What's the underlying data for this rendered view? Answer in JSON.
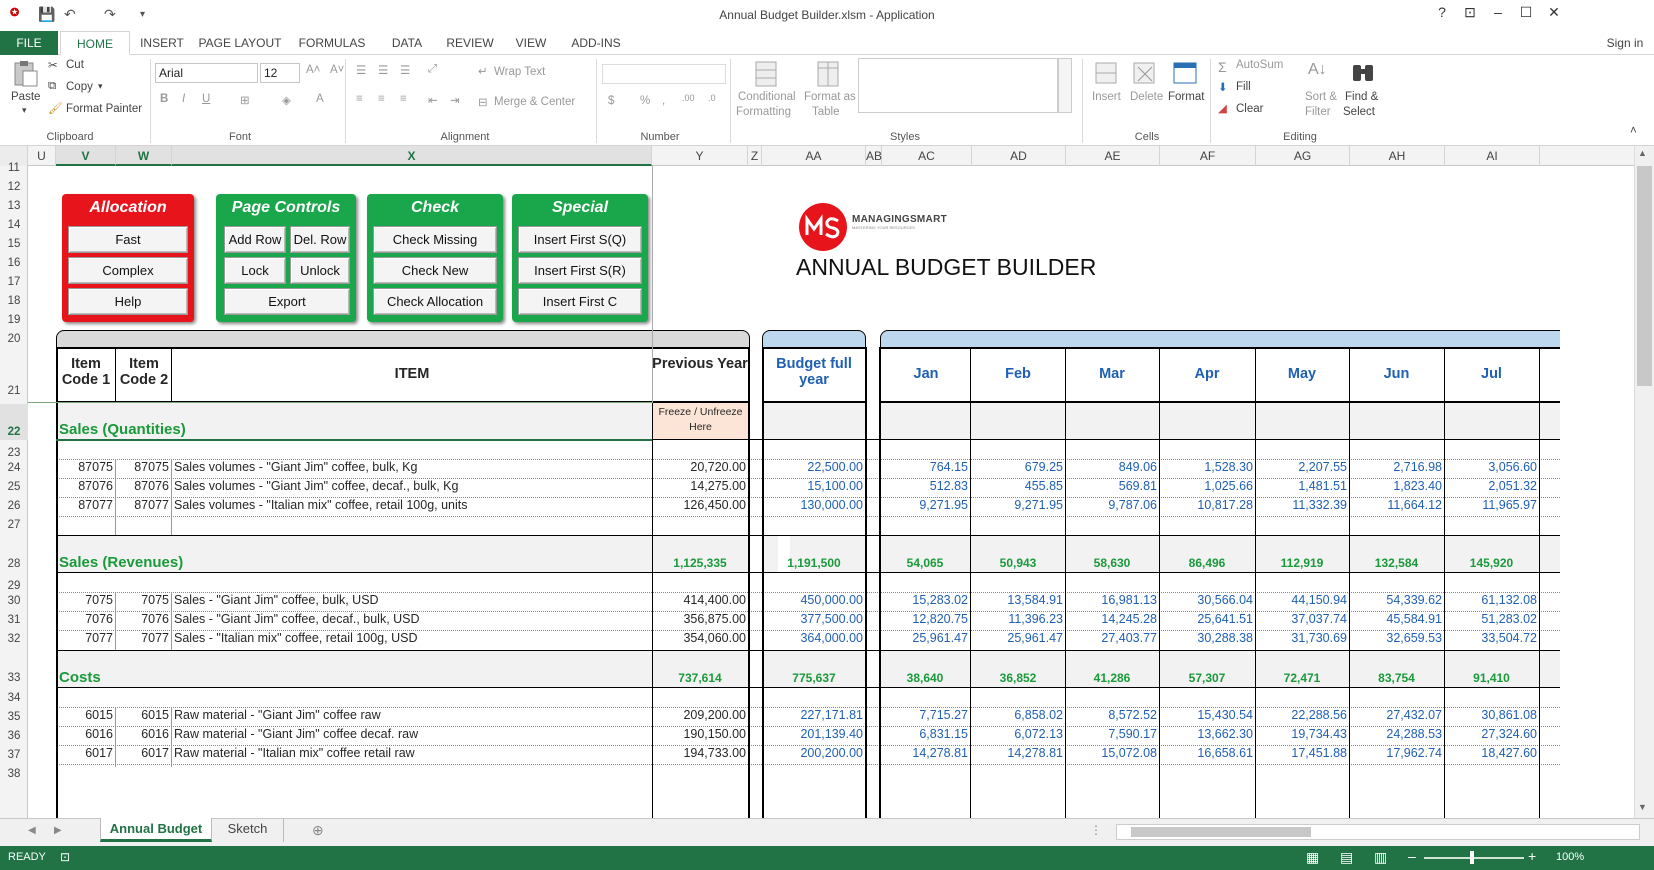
{
  "window": {
    "title": "Annual Budget Builder.xlsm - Application"
  },
  "ribbon_tabs": [
    "FILE",
    "HOME",
    "INSERT",
    "PAGE LAYOUT",
    "FORMULAS",
    "DATA",
    "REVIEW",
    "VIEW",
    "ADD-INS"
  ],
  "sign_in": "Sign in",
  "clipboard": {
    "paste": "Paste",
    "cut": "Cut",
    "copy": "Copy",
    "format_painter": "Format Painter",
    "label": "Clipboard"
  },
  "font": {
    "name": "Arial",
    "size": "12",
    "label": "Font"
  },
  "alignment": {
    "wrap": "Wrap Text",
    "merge": "Merge & Center",
    "label": "Alignment"
  },
  "number": {
    "label": "Number",
    "currency": "$",
    "percent": "%"
  },
  "styles": {
    "conditional": "Conditional",
    "formatting": "Formatting",
    "format_as": "Format as",
    "table": "Table",
    "label": "Styles"
  },
  "cells": {
    "insert": "Insert",
    "delete": "Delete",
    "format": "Format",
    "label": "Cells"
  },
  "editing": {
    "autosum": "AutoSum",
    "fill": "Fill",
    "clear": "Clear",
    "sort": "Sort &",
    "filter": "Filter",
    "find": "Find &",
    "select": "Select",
    "label": "Editing"
  },
  "columns": [
    "U",
    "V",
    "W",
    "X",
    "Y",
    "Z",
    "AA",
    "AB",
    "AC",
    "AD",
    "AE",
    "AF",
    "AG",
    "AH",
    "AI"
  ],
  "rows": [
    "11",
    "12",
    "13",
    "14",
    "15",
    "16",
    "17",
    "18",
    "19",
    "20",
    "21",
    "22",
    "23",
    "24",
    "25",
    "26",
    "27",
    "28",
    "29",
    "30",
    "31",
    "32",
    "33",
    "34",
    "35",
    "36",
    "37",
    "38"
  ],
  "macros": {
    "allocation": {
      "title": "Allocation",
      "buttons": [
        "Fast",
        "Complex",
        "Help"
      ]
    },
    "page": {
      "title": "Page Controls",
      "buttons": [
        "Add Row",
        "Del. Row",
        "Lock",
        "Unlock",
        "Export"
      ]
    },
    "check": {
      "title": "Check",
      "buttons": [
        "Check Missing",
        "Check New",
        "Check Allocation"
      ]
    },
    "special": {
      "title": "Special",
      "buttons": [
        "Insert First S(Q)",
        "Insert First S(R)",
        "Insert First C"
      ]
    }
  },
  "logo": {
    "brand": "MANAGINGSMART",
    "tagline": "MASTERING YOUR RESOURCES",
    "title": "ANNUAL BUDGET BUILDER"
  },
  "headers": {
    "code1": "Item Code 1",
    "code2": "Item Code 2",
    "item": "ITEM",
    "prev": "Previous Year",
    "budget": "Budget full year",
    "freeze": "Freeze / Unfreeze Here"
  },
  "months": [
    "Jan",
    "Feb",
    "Mar",
    "Apr",
    "May",
    "Jun",
    "Jul"
  ],
  "sections": [
    {
      "title": "Sales (Quantities)",
      "prev": "",
      "budget": "",
      "months": [
        "",
        "",
        "",
        "",
        "",
        "",
        ""
      ]
    },
    {
      "title": "Sales (Revenues)",
      "prev": "1,125,335",
      "budget": "1,191,500",
      "months": [
        "54,065",
        "50,943",
        "58,630",
        "86,496",
        "112,919",
        "132,584",
        "145,920"
      ]
    },
    {
      "title": "Costs",
      "prev": "737,614",
      "budget": "775,637",
      "months": [
        "38,640",
        "36,852",
        "41,286",
        "57,307",
        "72,471",
        "83,754",
        "91,410"
      ]
    }
  ],
  "data_rows": [
    {
      "c1": "87075",
      "c2": "87075",
      "item": "Sales volumes - \"Giant Jim\" coffee, bulk, Kg",
      "prev": "20,720.00",
      "budget": "22,500.00",
      "m": [
        "764.15",
        "679.25",
        "849.06",
        "1,528.30",
        "2,207.55",
        "2,716.98",
        "3,056.60"
      ]
    },
    {
      "c1": "87076",
      "c2": "87076",
      "item": "Sales volumes - \"Giant Jim\" coffee, decaf., bulk, Kg",
      "prev": "14,275.00",
      "budget": "15,100.00",
      "m": [
        "512.83",
        "455.85",
        "569.81",
        "1,025.66",
        "1,481.51",
        "1,823.40",
        "2,051.32"
      ]
    },
    {
      "c1": "87077",
      "c2": "87077",
      "item": "Sales volumes - \"Italian mix\" coffee, retail 100g, units",
      "prev": "126,450.00",
      "budget": "130,000.00",
      "m": [
        "9,271.95",
        "9,271.95",
        "9,787.06",
        "10,817.28",
        "11,332.39",
        "11,664.12",
        "11,965.97"
      ]
    },
    {
      "c1": "7075",
      "c2": "7075",
      "item": "Sales - \"Giant Jim\" coffee, bulk, USD",
      "prev": "414,400.00",
      "budget": "450,000.00",
      "m": [
        "15,283.02",
        "13,584.91",
        "16,981.13",
        "30,566.04",
        "44,150.94",
        "54,339.62",
        "61,132.08"
      ]
    },
    {
      "c1": "7076",
      "c2": "7076",
      "item": "Sales - \"Giant Jim\" coffee, decaf., bulk, USD",
      "prev": "356,875.00",
      "budget": "377,500.00",
      "m": [
        "12,820.75",
        "11,396.23",
        "14,245.28",
        "25,641.51",
        "37,037.74",
        "45,584.91",
        "51,283.02"
      ]
    },
    {
      "c1": "7077",
      "c2": "7077",
      "item": "Sales - \"Italian mix\" coffee, retail 100g, USD",
      "prev": "354,060.00",
      "budget": "364,000.00",
      "m": [
        "25,961.47",
        "25,961.47",
        "27,403.77",
        "30,288.38",
        "31,730.69",
        "32,659.53",
        "33,504.72"
      ]
    },
    {
      "c1": "6015",
      "c2": "6015",
      "item": "Raw material - \"Giant Jim\" coffee raw",
      "prev": "209,200.00",
      "budget": "227,171.81",
      "m": [
        "7,715.27",
        "6,858.02",
        "8,572.52",
        "15,430.54",
        "22,288.56",
        "27,432.07",
        "30,861.08"
      ]
    },
    {
      "c1": "6016",
      "c2": "6016",
      "item": "Raw material - \"Giant Jim\" coffee decaf. raw",
      "prev": "190,150.00",
      "budget": "201,139.40",
      "m": [
        "6,831.15",
        "6,072.13",
        "7,590.17",
        "13,662.30",
        "19,734.43",
        "24,288.53",
        "27,324.60"
      ]
    },
    {
      "c1": "6017",
      "c2": "6017",
      "item": "Raw material - \"Italian mix\" coffee retail raw",
      "prev": "194,733.00",
      "budget": "200,200.00",
      "m": [
        "14,278.81",
        "14,278.81",
        "15,072.08",
        "16,658.61",
        "17,451.88",
        "17,962.74",
        "18,427.60"
      ]
    }
  ],
  "sheets": [
    "Annual Budget",
    "Sketch"
  ],
  "status": {
    "ready": "READY",
    "zoom": "100%"
  }
}
